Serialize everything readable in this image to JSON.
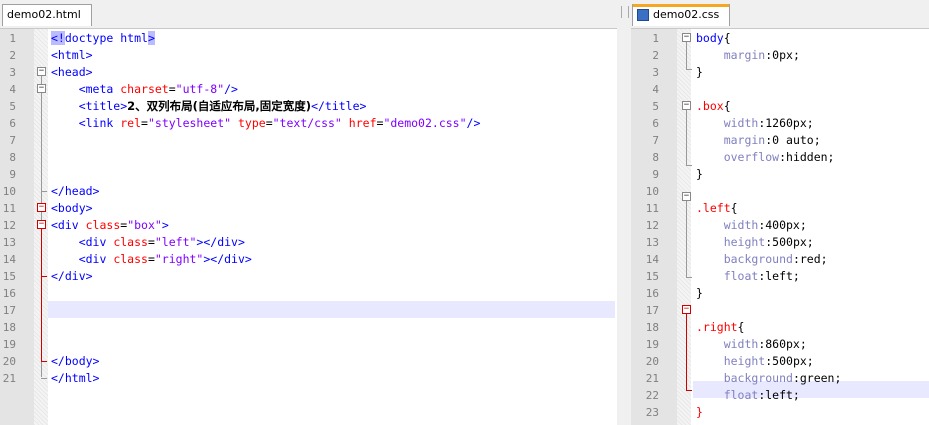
{
  "left": {
    "tab_label": "demo02.html",
    "close_glyph": "✕",
    "lines": [
      {
        "n": "1",
        "parts": [
          {
            "t": "<!",
            "c": "c-tag hl"
          },
          {
            "t": "doctype html",
            "c": "c-tag"
          },
          {
            "t": ">",
            "c": "c-tag hl"
          }
        ]
      },
      {
        "n": "2",
        "parts": [
          {
            "t": "<html>",
            "c": "c-tag"
          }
        ]
      },
      {
        "n": "3",
        "parts": [
          {
            "t": "<head>",
            "c": "c-tag"
          }
        ]
      },
      {
        "n": "4",
        "parts": [
          {
            "t": "    <meta ",
            "c": "c-tag"
          },
          {
            "t": "charset",
            "c": "c-attr"
          },
          {
            "t": "=",
            "c": "c-txt"
          },
          {
            "t": "\"utf-8\"",
            "c": "c-str"
          },
          {
            "t": "/>",
            "c": "c-tag"
          }
        ]
      },
      {
        "n": "5",
        "parts": [
          {
            "t": "    <title>",
            "c": "c-tag"
          },
          {
            "t": "2、双列布局(自适应布局,固定宽度)",
            "c": "c-txt cjk"
          },
          {
            "t": "</title>",
            "c": "c-tag"
          }
        ]
      },
      {
        "n": "6",
        "parts": [
          {
            "t": "    <link ",
            "c": "c-tag"
          },
          {
            "t": "rel",
            "c": "c-attr"
          },
          {
            "t": "=",
            "c": "c-txt"
          },
          {
            "t": "\"stylesheet\"",
            "c": "c-str"
          },
          {
            "t": " type",
            "c": "c-attr"
          },
          {
            "t": "=",
            "c": "c-txt"
          },
          {
            "t": "\"text/css\"",
            "c": "c-str"
          },
          {
            "t": " href",
            "c": "c-attr"
          },
          {
            "t": "=",
            "c": "c-txt"
          },
          {
            "t": "\"demo02.css\"",
            "c": "c-str"
          },
          {
            "t": "/>",
            "c": "c-tag"
          }
        ]
      },
      {
        "n": "7",
        "parts": []
      },
      {
        "n": "8",
        "parts": []
      },
      {
        "n": "9",
        "parts": []
      },
      {
        "n": "10",
        "parts": [
          {
            "t": "</head>",
            "c": "c-tag"
          }
        ]
      },
      {
        "n": "11",
        "parts": [
          {
            "t": "<body>",
            "c": "c-tag"
          }
        ]
      },
      {
        "n": "12",
        "parts": [
          {
            "t": "<div ",
            "c": "c-tag"
          },
          {
            "t": "class",
            "c": "c-attr"
          },
          {
            "t": "=",
            "c": "c-txt"
          },
          {
            "t": "\"box\"",
            "c": "c-str"
          },
          {
            "t": ">",
            "c": "c-tag"
          }
        ]
      },
      {
        "n": "13",
        "parts": [
          {
            "t": "    <div ",
            "c": "c-tag"
          },
          {
            "t": "class",
            "c": "c-attr"
          },
          {
            "t": "=",
            "c": "c-txt"
          },
          {
            "t": "\"left\"",
            "c": "c-str"
          },
          {
            "t": "></div>",
            "c": "c-tag"
          }
        ]
      },
      {
        "n": "14",
        "parts": [
          {
            "t": "    <div ",
            "c": "c-tag"
          },
          {
            "t": "class",
            "c": "c-attr"
          },
          {
            "t": "=",
            "c": "c-txt"
          },
          {
            "t": "\"right\"",
            "c": "c-str"
          },
          {
            "t": "></div>",
            "c": "c-tag"
          }
        ]
      },
      {
        "n": "15",
        "parts": [
          {
            "t": "</div>",
            "c": "c-tag"
          }
        ]
      },
      {
        "n": "16",
        "parts": []
      },
      {
        "n": "17",
        "parts": []
      },
      {
        "n": "18",
        "parts": []
      },
      {
        "n": "19",
        "parts": []
      },
      {
        "n": "20",
        "parts": [
          {
            "t": "</body>",
            "c": "c-tag"
          }
        ]
      },
      {
        "n": "21",
        "parts": [
          {
            "t": "</html>",
            "c": "c-tag"
          }
        ]
      }
    ]
  },
  "right": {
    "tab_label": "demo02.css",
    "close_glyph": "✕",
    "lines": [
      {
        "n": "1",
        "parts": [
          {
            "t": "body",
            "c": "c-css-sel"
          },
          {
            "t": "{",
            "c": "c-txt"
          }
        ]
      },
      {
        "n": "2",
        "parts": [
          {
            "t": "    margin",
            "c": "c-css-prop"
          },
          {
            "t": ":0px;",
            "c": "c-css-val"
          }
        ]
      },
      {
        "n": "3",
        "parts": [
          {
            "t": "}",
            "c": "c-txt"
          }
        ]
      },
      {
        "n": "4",
        "parts": []
      },
      {
        "n": "5",
        "parts": [
          {
            "t": ".box",
            "c": "c-sel-red"
          },
          {
            "t": "{",
            "c": "c-txt"
          }
        ]
      },
      {
        "n": "6",
        "parts": [
          {
            "t": "    width",
            "c": "c-css-prop"
          },
          {
            "t": ":1260px;",
            "c": "c-css-val"
          }
        ]
      },
      {
        "n": "7",
        "parts": [
          {
            "t": "    margin",
            "c": "c-css-prop"
          },
          {
            "t": ":0 auto;",
            "c": "c-css-val"
          }
        ]
      },
      {
        "n": "8",
        "parts": [
          {
            "t": "    overflow",
            "c": "c-css-prop"
          },
          {
            "t": ":hidden;",
            "c": "c-css-val"
          }
        ]
      },
      {
        "n": "9",
        "parts": [
          {
            "t": "}",
            "c": "c-txt"
          }
        ]
      },
      {
        "n": "10",
        "parts": []
      },
      {
        "n": "11",
        "parts": [
          {
            "t": ".left",
            "c": "c-sel-red"
          },
          {
            "t": "{",
            "c": "c-txt"
          }
        ]
      },
      {
        "n": "12",
        "parts": [
          {
            "t": "    width",
            "c": "c-css-prop"
          },
          {
            "t": ":400px;",
            "c": "c-css-val"
          }
        ]
      },
      {
        "n": "13",
        "parts": [
          {
            "t": "    height",
            "c": "c-css-prop"
          },
          {
            "t": ":500px;",
            "c": "c-css-val"
          }
        ]
      },
      {
        "n": "14",
        "parts": [
          {
            "t": "    background",
            "c": "c-css-prop"
          },
          {
            "t": ":red;",
            "c": "c-css-val"
          }
        ]
      },
      {
        "n": "15",
        "parts": [
          {
            "t": "    float",
            "c": "c-css-prop"
          },
          {
            "t": ":left;",
            "c": "c-css-val"
          }
        ]
      },
      {
        "n": "16",
        "parts": [
          {
            "t": "}",
            "c": "c-txt"
          }
        ]
      },
      {
        "n": "17",
        "parts": []
      },
      {
        "n": "18",
        "parts": [
          {
            "t": ".right",
            "c": "c-sel-red"
          },
          {
            "t": "{",
            "c": "c-txt"
          }
        ]
      },
      {
        "n": "19",
        "parts": [
          {
            "t": "    width",
            "c": "c-css-prop"
          },
          {
            "t": ":860px;",
            "c": "c-css-val"
          }
        ]
      },
      {
        "n": "20",
        "parts": [
          {
            "t": "    height",
            "c": "c-css-prop"
          },
          {
            "t": ":500px;",
            "c": "c-css-val"
          }
        ]
      },
      {
        "n": "21",
        "parts": [
          {
            "t": "    background",
            "c": "c-css-prop"
          },
          {
            "t": ":green;",
            "c": "c-css-val"
          }
        ]
      },
      {
        "n": "22",
        "parts": [
          {
            "t": "    float",
            "c": "c-css-prop"
          },
          {
            "t": ":left;",
            "c": "c-css-val"
          }
        ]
      },
      {
        "n": "23",
        "parts": [
          {
            "t": "}",
            "c": "c-sel-red"
          }
        ]
      }
    ]
  }
}
